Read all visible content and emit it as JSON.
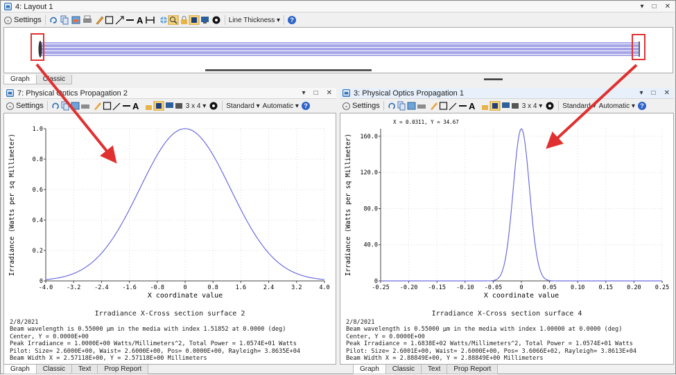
{
  "layout": {
    "title": "4: Layout 1",
    "toolbar": {
      "settings": "Settings",
      "line_thickness": "Line Thickness"
    },
    "tabs": [
      "Graph",
      "Classic"
    ]
  },
  "pop_left": {
    "title": "7: Physical Optics Propagation 2",
    "toolbar": {
      "settings": "Settings",
      "grid": "3 x 4",
      "standard": "Standard",
      "automatic": "Automatic"
    },
    "chart_data": {
      "type": "line",
      "xlabel": "X coordinate value",
      "ylabel": "Irradiance (Watts per sq Millimeter)",
      "xlim": [
        -4.0,
        4.0
      ],
      "ylim": [
        0,
        1.0
      ],
      "xticks": [
        "-4.0",
        "-3.2",
        "-2.4",
        "-1.6",
        "-0.8",
        "0",
        "0.8",
        "1.6",
        "2.4",
        "3.2",
        "4.0"
      ],
      "yticks": [
        "0",
        "0.2",
        "0.4",
        "0.6",
        "0.8",
        "1.0"
      ],
      "series": [
        {
          "color": "#6b6bdf",
          "gaussian_peak": 1.0,
          "gaussian_width_x": 2.6
        }
      ],
      "grid": true
    },
    "caption": "Irradiance X-Cross section surface 2",
    "info": [
      "2/8/2021",
      "Beam wavelength is 0.55000 µm in the media with index 1.51852 at 0.0000 (deg)",
      "Center, Y = 0.0000E+00",
      "Peak Irradiance = 1.0000E+00 Watts/Millimeters^2, Total Power = 1.0574E+01 Watts",
      "Pilot: Size= 2.6000E+00, Waist= 2.6000E+00, Pos= 0.0000E+00, Rayleigh= 3.8635E+04",
      "Beam Width X = 2.57118E+00, Y = 2.57118E+00 Millimeters"
    ],
    "tabs": [
      "Graph",
      "Classic",
      "Text",
      "Prop Report"
    ]
  },
  "pop_right": {
    "title": "3: Physical Optics Propagation 1",
    "toolbar": {
      "settings": "Settings",
      "grid": "3 x 4",
      "standard": "Standard",
      "automatic": "Automatic"
    },
    "chart_data": {
      "type": "line",
      "xlabel": "X coordinate value",
      "ylabel": "Irradiance (Watts per sq Millimeter)",
      "readout": "X = 0.0311, Y = 34.67",
      "xlim": [
        -0.25,
        0.25
      ],
      "ylim": [
        0,
        168.4
      ],
      "xticks": [
        "-0.25",
        "-0.20",
        "-0.15",
        "-0.10",
        "-0.05",
        "0",
        "0.05",
        "0.10",
        "0.15",
        "0.20",
        "0.25"
      ],
      "yticks": [
        "0",
        "40.0",
        "80.0",
        "120.0",
        "160.0"
      ],
      "series": [
        {
          "color": "#6b6bdf",
          "gaussian_peak": 168.38,
          "gaussian_width_x": 0.0289
        }
      ],
      "grid": true
    },
    "caption": "Irradiance X-Cross section surface 4",
    "info": [
      "2/8/2021",
      "Beam wavelength is 0.55000 µm in the media with index 1.00000 at 0.0000 (deg)",
      "Center, Y = 0.0000E+00",
      "Peak Irradiance = 1.6838E+02 Watts/Millimeters^2, Total Power = 1.0574E+01 Watts",
      "Pilot: Size= 2.6001E+00, Waist= 2.6000E+00, Pos= 3.6066E+02, Rayleigh= 3.8613E+04",
      "Beam Width X = 2.88849E+00, Y = 2.88849E+00 Millimeters"
    ],
    "tabs": [
      "Graph",
      "Classic",
      "Text",
      "Prop Report"
    ]
  },
  "colors": {
    "annotation_red": "#e03030",
    "beam": "#6b6bdf",
    "accent_blue": "#2e63c8"
  }
}
